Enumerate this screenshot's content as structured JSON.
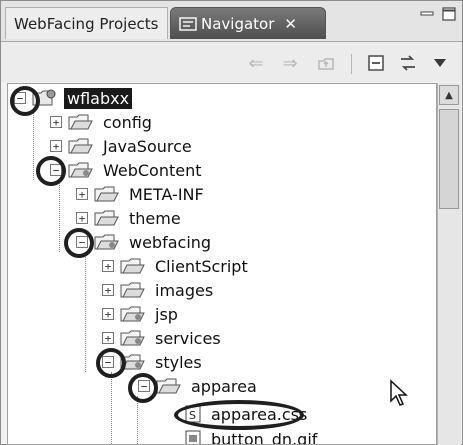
{
  "tabs": [
    {
      "label": "WebFacing Projects",
      "active": false
    },
    {
      "label": "Navigator",
      "active": true,
      "close": "✕"
    }
  ],
  "window_buttons": [
    "minimize-icon",
    "maximize-icon"
  ],
  "toolbar": [
    "back-arrow-icon",
    "forward-arrow-icon",
    "up-folder-icon",
    "collapse-all-icon",
    "link-with-editor-icon",
    "view-menu-icon"
  ],
  "tree": [
    {
      "label": "wflabxx",
      "expanded": true,
      "selected": true,
      "icon": "project-icon"
    },
    {
      "label": "config",
      "expanded": false,
      "icon": "folder-icon"
    },
    {
      "label": "JavaSource",
      "expanded": false,
      "icon": "folder-icon"
    },
    {
      "label": "WebContent",
      "expanded": true,
      "icon": "folder-icon"
    },
    {
      "label": "META-INF",
      "expanded": false,
      "icon": "folder-icon"
    },
    {
      "label": "theme",
      "expanded": false,
      "icon": "folder-icon"
    },
    {
      "label": "webfacing",
      "expanded": true,
      "icon": "folder-icon"
    },
    {
      "label": "ClientScript",
      "expanded": false,
      "icon": "folder-icon"
    },
    {
      "label": "images",
      "expanded": false,
      "icon": "folder-icon"
    },
    {
      "label": "jsp",
      "expanded": false,
      "icon": "folder-icon"
    },
    {
      "label": "services",
      "expanded": false,
      "icon": "folder-icon"
    },
    {
      "label": "styles",
      "expanded": true,
      "icon": "folder-icon"
    },
    {
      "label": "apparea",
      "expanded": true,
      "icon": "folder-icon"
    },
    {
      "label": "apparea.css",
      "icon": "css-file-icon"
    },
    {
      "label": "button_dn.gif",
      "icon": "gif-file-icon"
    }
  ],
  "colors": {
    "selection": "#1a1a1a",
    "active_tab": "#5e5e5e",
    "annotation": "#1f1f1f"
  }
}
